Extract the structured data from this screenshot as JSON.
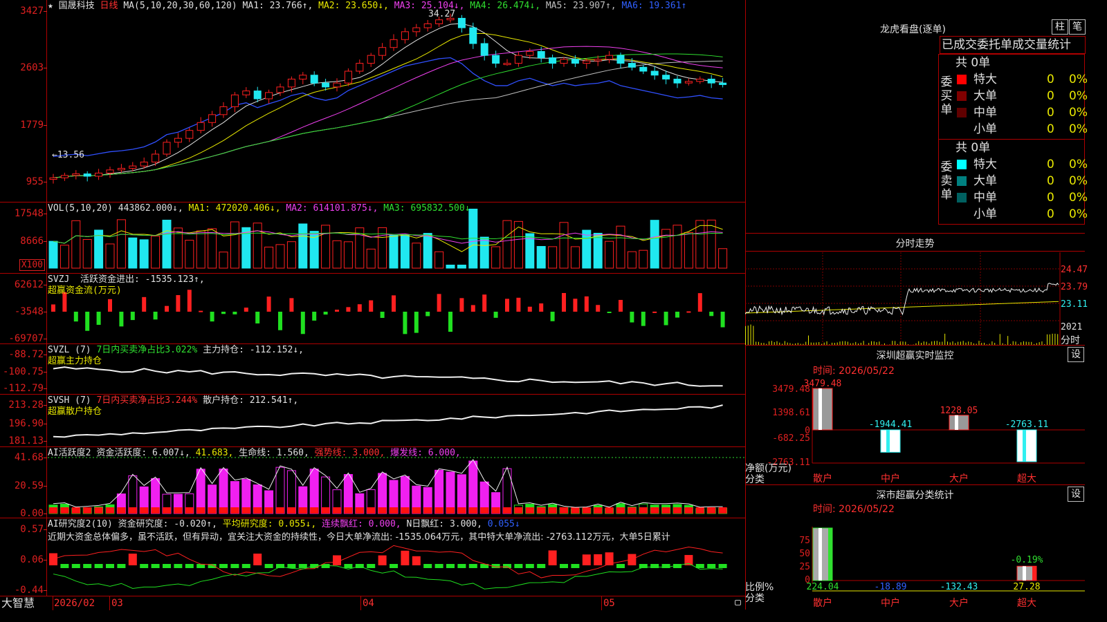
{
  "stock": {
    "name": "国晟科技",
    "period": "日线",
    "ma_label": "MA(5,10,20,30,60,120)",
    "star": "★"
  },
  "main_ma": [
    {
      "text": "MA1: 23.766↑,",
      "color": "#e0e0e0"
    },
    {
      "text": "MA2: 23.650↓,",
      "color": "#e8e800"
    },
    {
      "text": "MA3: 25.104↓,",
      "color": "#f040f0"
    },
    {
      "text": "MA4: 26.474↓,",
      "color": "#30e030"
    },
    {
      "text": "MA5: 23.907↑,",
      "color": "#c0c0c0"
    },
    {
      "text": "MA6: 19.361↑",
      "color": "#3060ff"
    }
  ],
  "price_axis": [
    "3427",
    "2603",
    "1779",
    "955"
  ],
  "price_marks": {
    "high": "34.27",
    "low": "←13.56"
  },
  "vol_hdr": {
    "label": "VOL(5,10,20)",
    "value": "443862.000↓,",
    "ma1": "MA1: 472020.406↓,",
    "ma2": "MA2: 614101.875↓,",
    "ma3": "MA3: 695832.500↓"
  },
  "vol_axis": [
    "17548",
    "8666",
    "X100"
  ],
  "svzj": {
    "label": "SVZJ",
    "text": "活跃资金进出: -1535.123↑,",
    "sub": "超赢资金流(万元)",
    "axis": [
      "62612",
      "-3548",
      "-69707"
    ]
  },
  "svzl": {
    "label": "SVZL (7)",
    "t1": "7日内买卖净占比3.022%",
    "t2": "主力持仓: -112.152↓,",
    "sub": "超赢主力持仓",
    "axis": [
      "-88.72",
      "-100.75",
      "-112.79"
    ]
  },
  "svsh": {
    "label": "SVSH (7)",
    "t1": "7日内买卖净占比3.244%",
    "t2": "散户持仓: 212.541↑,",
    "sub": "超赢散户持仓",
    "axis": [
      "213.28",
      "196.90",
      "181.13"
    ]
  },
  "ai1": {
    "label": "AI活跃度2",
    "t1": "资金活跃度: 6.007↓,",
    "t2": "41.683,",
    "t3": "生命线: 1.560,",
    "t4": "强势线: 3.000,",
    "t5": "爆发线: 6.000,",
    "axis": [
      "41.68",
      "20.59",
      "0.00"
    ]
  },
  "ai2": {
    "label": "AI研究度2(10)",
    "t1": "资金研究度: -0.020↑,",
    "t2": "平均研究度: 0.055↓,",
    "t3": "连续飘红: 0.000,",
    "t4": "N日飘红: 3.000,",
    "t5": "0.055↓",
    "comment": "近期大资金总体偏多，虽不活跃，但有异动，宜关注大资金的持续性，今日大单净流出: -1535.064万元，其中特大单净流出: -2763.112万元，大单5日累计",
    "axis": [
      "0.57",
      "0.06",
      "-0.44"
    ]
  },
  "dates": {
    "month1": "2026/02",
    "month2": "03",
    "month3": "04",
    "month4": "05"
  },
  "brand": "大智慧",
  "right": {
    "lhb_title": "龙虎看盘(逐单)",
    "btn_zhu": "柱",
    "btn_bi": "笔",
    "table_header": "已成交委托单成交量统计",
    "buy_label": "委买单",
    "sell_label": "委卖单",
    "buy_total": "共 0单",
    "sell_total": "共 0单",
    "buy_rows": [
      {
        "name": "特大",
        "v": "0",
        "p": "0%",
        "c": "#ff0000"
      },
      {
        "name": "大单",
        "v": "0",
        "p": "0%",
        "c": "#800000"
      },
      {
        "name": "中单",
        "v": "0",
        "p": "0%",
        "c": "#600000"
      },
      {
        "name": "小单",
        "v": "0",
        "p": "0%",
        "c": "#000000"
      }
    ],
    "sell_rows": [
      {
        "name": "特大",
        "v": "0",
        "p": "0%",
        "c": "#00ffff"
      },
      {
        "name": "大单",
        "v": "0",
        "p": "0%",
        "c": "#008080"
      },
      {
        "name": "中单",
        "v": "0",
        "p": "0%",
        "c": "#006060"
      },
      {
        "name": "小单",
        "v": "0",
        "p": "0%",
        "c": "#000000"
      }
    ],
    "intraday_title": "分时走势",
    "intraday_axis": [
      "24.47",
      "23.79",
      "23.11"
    ],
    "intraday_date": "2021",
    "intraday_unit": "分时",
    "sz_title": "深圳超赢实时监控",
    "sz_btn": "设",
    "sz_time": "时间: 2026/05/22",
    "sz_axis": [
      "3479.48",
      "1398.61",
      "0",
      "-682.25",
      "-2763.11"
    ],
    "sz_bars": [
      {
        "cat": "散户",
        "val": "3479.48",
        "v": 3479.48
      },
      {
        "cat": "中户",
        "val": "-1944.41",
        "v": -1944.41
      },
      {
        "cat": "大户",
        "val": "1228.05",
        "v": 1228.05
      },
      {
        "cat": "超大",
        "val": "-2763.11",
        "v": -2763.11
      }
    ],
    "sz_ylabel": "净额(万元)",
    "sz_xlabel": "分类",
    "cls_title": "深市超赢分类统计",
    "cls_btn": "设",
    "cls_time": "时间: 2026/05/22",
    "cls_axis": [
      "75",
      "50",
      "25",
      "0"
    ],
    "cls_bars": [
      {
        "cat": "散户",
        "val": "224.04",
        "h": 100
      },
      {
        "cat": "中户",
        "val": "-18.89",
        "h": 0
      },
      {
        "cat": "大户",
        "val": "-132.43",
        "h": 0
      },
      {
        "cat": "超大",
        "val": "27.28",
        "h": 27.28,
        "top": "-0.19%"
      }
    ],
    "cls_ylabel": "比例%",
    "cls_xlabel": "分类"
  }
}
